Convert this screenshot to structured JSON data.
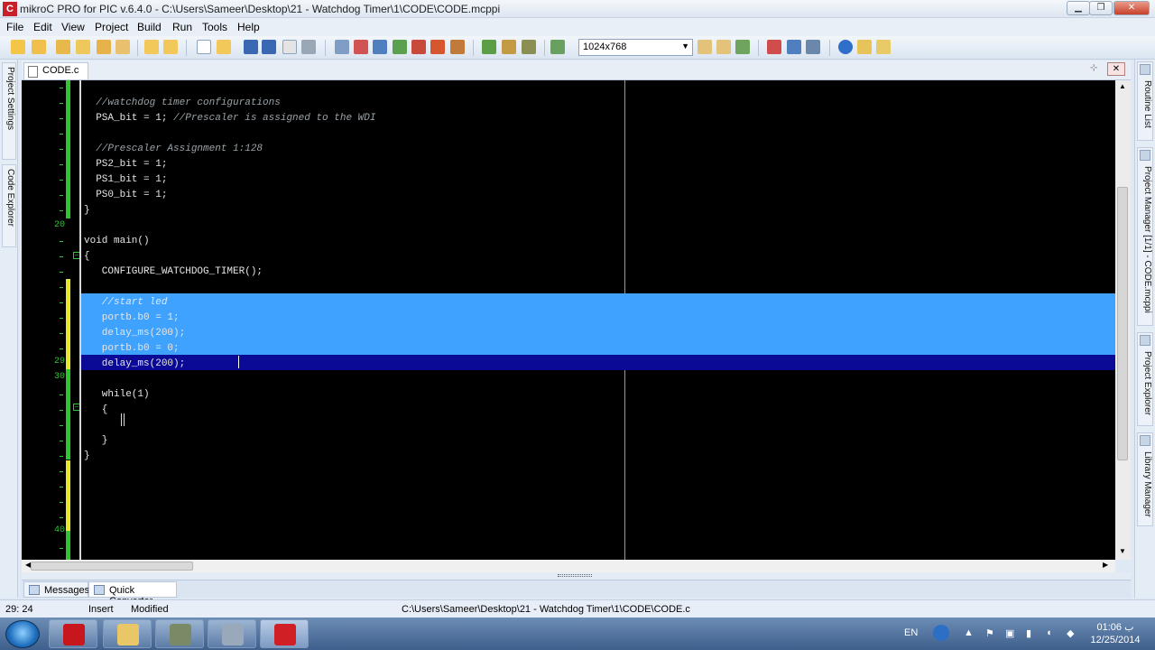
{
  "window": {
    "title": "mikroC PRO for PIC v.6.4.0 - C:\\Users\\Sameer\\Desktop\\21 - Watchdog Timer\\1\\CODE\\CODE.mcppi",
    "app_icon": "mikroc-logo-icon"
  },
  "menu": [
    "File",
    "Edit",
    "View",
    "Project",
    "Build",
    "Run",
    "Tools",
    "Help"
  ],
  "toolbar": {
    "resolution_value": "1024x768"
  },
  "left_tabs": [
    "Project Settings",
    "Code Explorer"
  ],
  "right_tabs": [
    "Routine List",
    "Project Manager [1/1] - CODE.mcppi",
    "Project Explorer",
    "Library Manager"
  ],
  "editor": {
    "tab_label": "CODE.c",
    "line_numbers": {
      "l20": "20",
      "l29": "29",
      "l30": "30",
      "l40": "40"
    },
    "lines": [
      {
        "text": "  //watchdog timer configurations",
        "comment": true
      },
      {
        "text": "  PSA_bit = 1; ",
        "trailing_comment": "//Prescaler is assigned to the WDI"
      },
      {
        "text": ""
      },
      {
        "text": "  //Prescaler Assignment 1:128",
        "comment": true
      },
      {
        "text": "  PS2_bit = 1;"
      },
      {
        "text": "  PS1_bit = 1;"
      },
      {
        "text": "  PS0_bit = 1;"
      },
      {
        "text": "}"
      },
      {
        "text": ""
      },
      {
        "text": "void main()"
      },
      {
        "text": "{"
      },
      {
        "text": "   CONFIGURE_WATCHDOG_TIMER();"
      },
      {
        "text": ""
      },
      {
        "text": "   //start led",
        "comment": true
      },
      {
        "text": "   portb.b0 = 1;"
      },
      {
        "text": "   delay_ms(200);"
      },
      {
        "text": "   portb.b0 = 0;"
      },
      {
        "text": "   delay_ms(200);"
      },
      {
        "text": ""
      },
      {
        "text": "   while(1)"
      },
      {
        "text": "   {"
      },
      {
        "text": ""
      },
      {
        "text": "   }"
      },
      {
        "text": "}"
      }
    ]
  },
  "bottom_tabs": [
    "Messages",
    "Quick Converter"
  ],
  "status": {
    "position": "29: 24",
    "mode": "Insert",
    "state": "Modified",
    "path": "C:\\Users\\Sameer\\Desktop\\21 - Watchdog Timer\\1\\CODE\\CODE.c"
  },
  "taskbar": {
    "language": "EN",
    "time": "01:06 ب",
    "date": "12/25/2014",
    "apps": [
      "acrobat-icon",
      "file-explorer-icon",
      "app-icon",
      "tool-icon",
      "mikroc-icon"
    ]
  },
  "colors": {
    "editor_bg": "#000000",
    "line_number": "#2ec52e",
    "selection": "#3fa2ff",
    "current_line_selection": "#0a0a96"
  }
}
